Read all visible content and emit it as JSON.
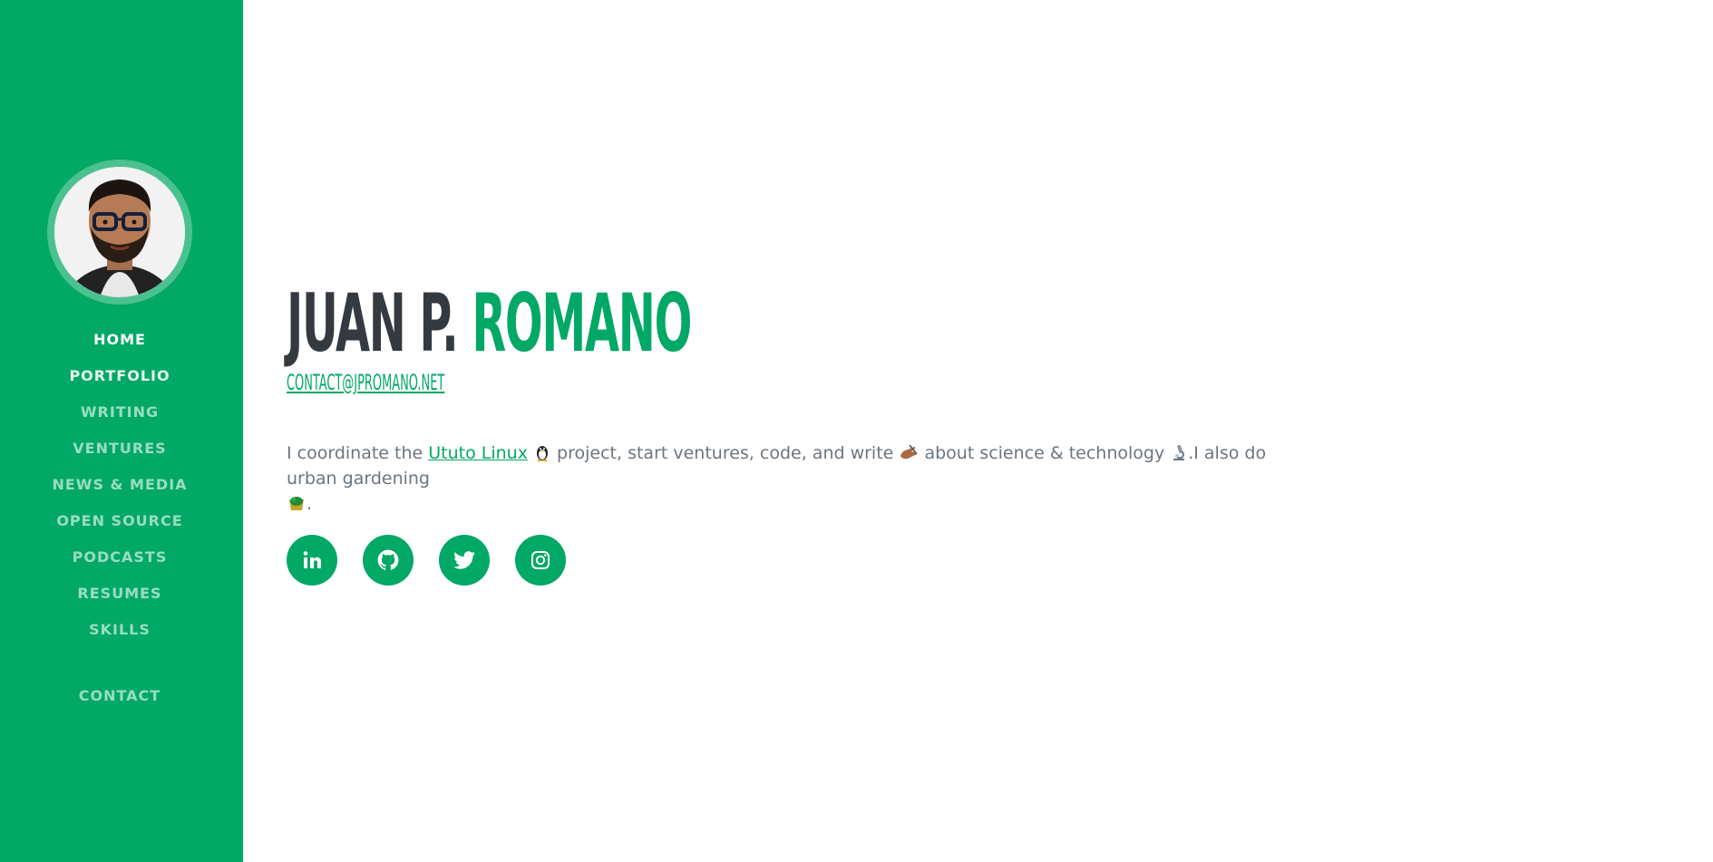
{
  "profile": {
    "photo_alt": "Juan P. Romano",
    "first_name": "JUAN P.",
    "last_name": "ROMANO",
    "email": "CONTACT@JPROMANO.NET"
  },
  "nav": {
    "items": [
      {
        "label": "HOME"
      },
      {
        "label": "PORTFOLIO"
      },
      {
        "label": "WRITING"
      },
      {
        "label": "VENTURES"
      },
      {
        "label": "NEWS & MEDIA"
      },
      {
        "label": "OPEN SOURCE"
      },
      {
        "label": "PODCASTS"
      },
      {
        "label": "RESUMES"
      },
      {
        "label": "SKILLS"
      }
    ],
    "contact_label": "CONTACT"
  },
  "bio": {
    "part1": "I coordinate the ",
    "link_text": "Ututo Linux",
    "part2": " project, start ventures, code, and write",
    "part3": " about science & technology ",
    "part4": ".I also do urban gardening ",
    "part5": "."
  },
  "social": [
    {
      "icon": "linkedin-icon"
    },
    {
      "icon": "github-icon"
    },
    {
      "icon": "twitter-icon"
    },
    {
      "icon": "instagram-icon"
    }
  ],
  "colors": {
    "brand": "#02a866",
    "heading_dark": "#343a40",
    "body_text": "#6c757d"
  }
}
